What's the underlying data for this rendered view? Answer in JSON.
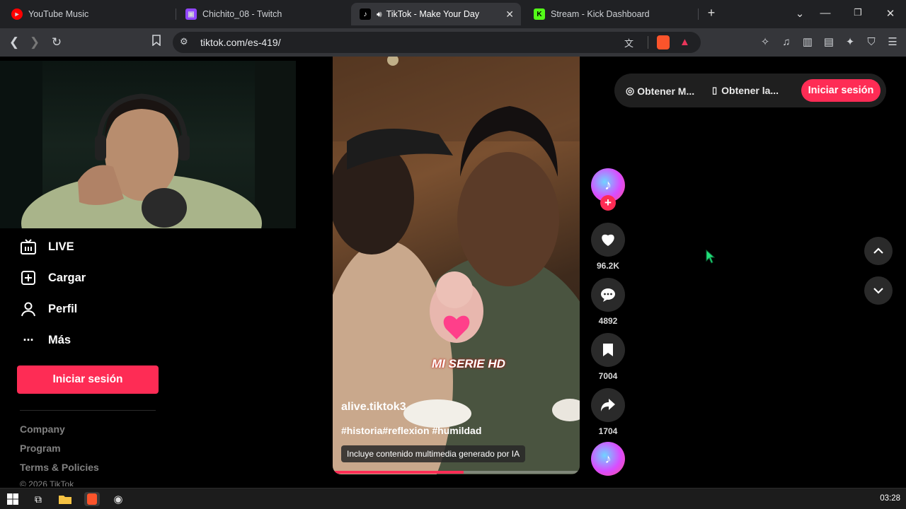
{
  "browser": {
    "tabs": [
      {
        "label": "YouTube Music",
        "favicon_color": "#ff0000"
      },
      {
        "label": "Chichito_08 - Twitch",
        "favicon_color": "#9146ff"
      },
      {
        "label": "TikTok - Make Your Day",
        "favicon_color": "#000000"
      },
      {
        "label": "Stream - Kick Dashboard",
        "favicon_color": "#53fc18"
      }
    ],
    "url": "tiktok.com/es-419/"
  },
  "sidebar": {
    "items": [
      {
        "label": "LIVE",
        "icon": "live-icon"
      },
      {
        "label": "Cargar",
        "icon": "upload-icon"
      },
      {
        "label": "Perfil",
        "icon": "profile-icon"
      },
      {
        "label": "Más",
        "icon": "more-icon"
      }
    ],
    "login_label": "Iniciar sesión",
    "footer": [
      "Company",
      "Program",
      "Terms & Policies",
      "© 2026 TikTok"
    ]
  },
  "video": {
    "author": "alive.tiktok3",
    "tags": "#historia#reflexion #humildad",
    "ai_label": "Incluye contenido multimedia generado por IA",
    "watermark": "MI SERIE HD",
    "progress": 0.53
  },
  "actions": {
    "likes": "96.2K",
    "comments": "4892",
    "saves": "7004",
    "shares": "1704"
  },
  "top_bar": {
    "get_app1": "Obtener M...",
    "get_app2": "Obtener la...",
    "login_label": "Iniciar sesión"
  },
  "taskbar": {
    "time": "03:28"
  },
  "colors": {
    "accent": "#fe2c55",
    "tab_bar": "#202124",
    "toolbar": "#35363a"
  }
}
